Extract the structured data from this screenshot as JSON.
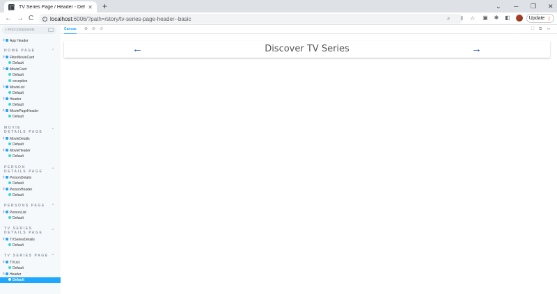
{
  "browser": {
    "tab_title": "TV Series Page / Header - Default",
    "tab_close": "✕",
    "new_tab": "+",
    "win_chevron": "⌄",
    "win_min": "─",
    "win_restore": "❐",
    "win_close": "✕",
    "back": "←",
    "forward": "→",
    "reload": "C",
    "url_host": "localhost",
    "url_path": ":6006/?path=/story/tv-series-page-header--basic",
    "update_label": "Update",
    "update_dots": "⋮"
  },
  "sidebar": {
    "search_placeholder": "Find components",
    "app_header": "App Header",
    "home_page": {
      "label": "HOME PAGE",
      "items": [
        {
          "name": "FilterMovieCard",
          "story": "Default"
        },
        {
          "name": "MovieCard",
          "stories": [
            "Default",
            "exception"
          ]
        },
        {
          "name": "MovieList",
          "story": "Default"
        },
        {
          "name": "Header",
          "story": "Default"
        },
        {
          "name": "MoviePageHeader",
          "story": "Default"
        }
      ]
    },
    "movie_details_page": {
      "label": "MOVIE DETAILS PAGE",
      "items": [
        {
          "name": "MovieDetails",
          "story": "Default"
        },
        {
          "name": "MovieHeader",
          "story": "Default"
        }
      ]
    },
    "person_details_page": {
      "label": "PERSON DETAILS PAGE",
      "items": [
        {
          "name": "PersonDetails",
          "story": "Default"
        },
        {
          "name": "PersonHeader",
          "story": "Default"
        }
      ]
    },
    "persons_page": {
      "label": "PERSONS PAGE",
      "items": [
        {
          "name": "PersonList",
          "story": "Default"
        }
      ]
    },
    "tv_series_details_page": {
      "label": "TV SERIES DETAILS PAGE",
      "items": [
        {
          "name": "TVSeriesDetails",
          "story": "Default"
        }
      ]
    },
    "tv_series_page": {
      "label": "TV SERIES PAGE",
      "items": [
        {
          "name": "TVList",
          "story": "Default"
        },
        {
          "name": "Header",
          "story": "Default"
        }
      ]
    },
    "chevron": "⌃"
  },
  "storybook": {
    "canvas_tab": "Canvas"
  },
  "preview": {
    "title": "Discover TV Series",
    "prev_arrow": "←",
    "next_arrow": "→"
  },
  "colors": {
    "accent": "#1ea7fd",
    "arrow": "#2a59b5"
  }
}
